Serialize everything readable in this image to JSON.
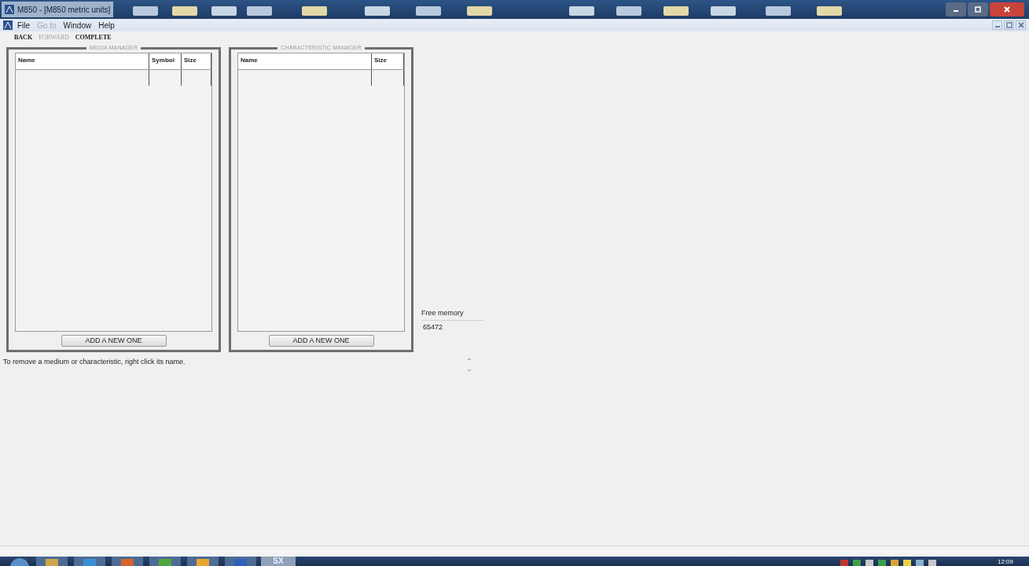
{
  "window": {
    "title": "M850 - [M850 metric units]"
  },
  "menu": [
    {
      "label": "File",
      "disabled": false
    },
    {
      "label": "Go to",
      "disabled": true
    },
    {
      "label": "Window",
      "disabled": false
    },
    {
      "label": "Help",
      "disabled": false
    }
  ],
  "toolbar": [
    {
      "label": "BACK",
      "disabled": false
    },
    {
      "label": "FORWARD",
      "disabled": true
    },
    {
      "label": "COMPLETE",
      "disabled": false
    }
  ],
  "panels": [
    {
      "title": "MEDIA MANAGER",
      "columns": [
        "Name",
        "Symbol",
        "Size"
      ],
      "button": "ADD A NEW ONE"
    },
    {
      "title": "CHARACTERISTIC MANAGER",
      "columns": [
        "Name",
        "Size"
      ],
      "button": "ADD A NEW ONE"
    }
  ],
  "free_memory": {
    "label": "Free memory",
    "value": "65472"
  },
  "status": "To remove a medium or characteristic, right click its name.",
  "taskbar": {
    "app_label": "SX",
    "clock": "12:09"
  }
}
